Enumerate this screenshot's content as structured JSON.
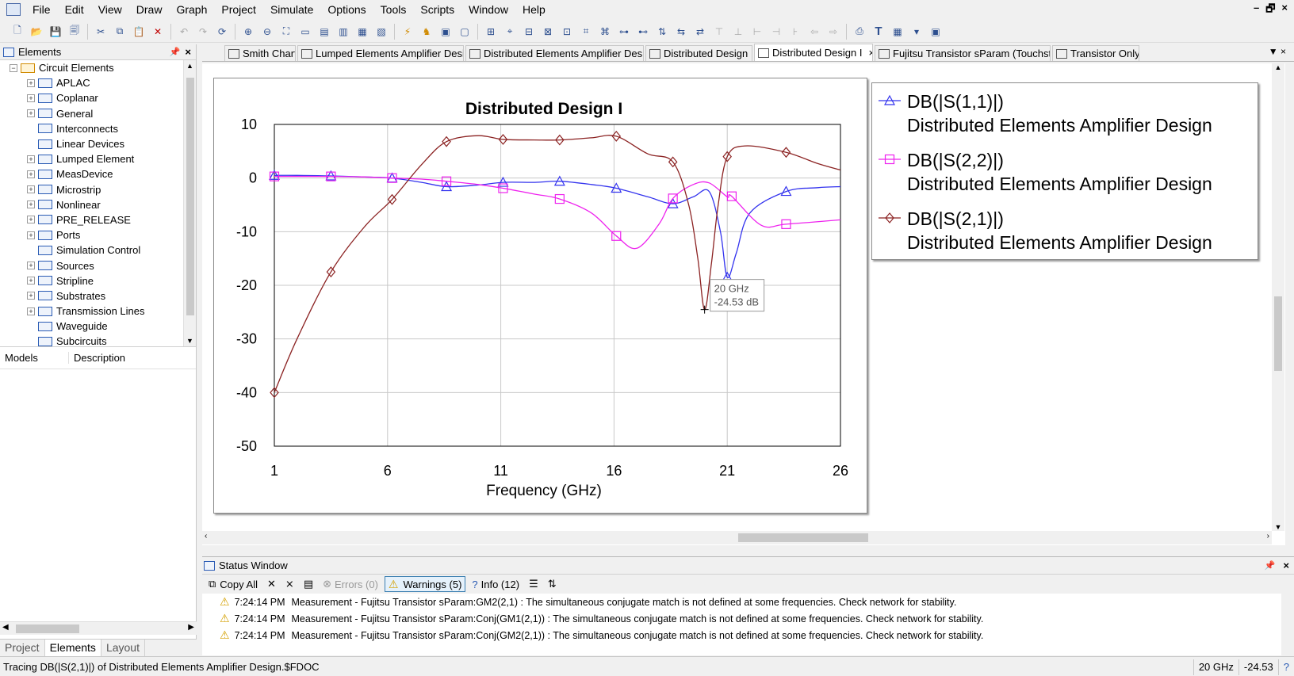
{
  "menu": {
    "items": [
      "File",
      "Edit",
      "View",
      "Draw",
      "Graph",
      "Project",
      "Simulate",
      "Options",
      "Tools",
      "Scripts",
      "Window",
      "Help"
    ]
  },
  "window_controls": [
    "–",
    "🗗",
    "×"
  ],
  "elements_panel": {
    "title": "Elements",
    "root": "Circuit Elements",
    "items": [
      {
        "label": "APLAC",
        "expandable": true
      },
      {
        "label": "Coplanar",
        "expandable": true
      },
      {
        "label": "General",
        "expandable": true
      },
      {
        "label": "Interconnects",
        "expandable": false
      },
      {
        "label": "Linear Devices",
        "expandable": false
      },
      {
        "label": "Lumped Element",
        "expandable": true
      },
      {
        "label": "MeasDevice",
        "expandable": true
      },
      {
        "label": "Microstrip",
        "expandable": true
      },
      {
        "label": "Nonlinear",
        "expandable": true
      },
      {
        "label": "PRE_RELEASE",
        "expandable": true
      },
      {
        "label": "Ports",
        "expandable": true
      },
      {
        "label": "Simulation Control",
        "expandable": false
      },
      {
        "label": "Sources",
        "expandable": true
      },
      {
        "label": "Stripline",
        "expandable": true
      },
      {
        "label": "Substrates",
        "expandable": true
      },
      {
        "label": "Transmission Lines",
        "expandable": true
      },
      {
        "label": "Waveguide",
        "expandable": false
      },
      {
        "label": "Subcircuits",
        "expandable": false
      }
    ],
    "models_header": {
      "col1": "Models",
      "col2": "Description"
    },
    "bottom_tabs": [
      "Project",
      "Elements",
      "Layout"
    ]
  },
  "doc_tabs": [
    {
      "label": "Smith Chart",
      "active": false
    },
    {
      "label": "Lumped Elements Amplifier Design",
      "active": false
    },
    {
      "label": "Distributed Elements Amplifier Des...",
      "active": false
    },
    {
      "label": "Distributed Design",
      "active": false
    },
    {
      "label": "Distributed Design I",
      "active": true
    },
    {
      "label": "Fujitsu Transistor sParam (Touchst...",
      "active": false
    },
    {
      "label": "Transistor Only",
      "active": false
    }
  ],
  "chart_data": {
    "type": "line",
    "title": "Distributed Design I",
    "xlabel": "Frequency (GHz)",
    "ylabel": "",
    "xlim": [
      1,
      26
    ],
    "ylim": [
      -50,
      10
    ],
    "xticks": [
      1,
      6,
      11,
      16,
      21,
      26
    ],
    "yticks": [
      10,
      0,
      -10,
      -20,
      -30,
      -40,
      -50
    ],
    "grid": true,
    "legend_position": "right",
    "series": [
      {
        "name": "DB(|S(1,1)|)",
        "source": "Distributed Elements Amplifier Design",
        "color": "#3333ee",
        "marker": "triangle",
        "x": [
          1,
          2,
          3.5,
          5,
          6.2,
          7.5,
          8.6,
          10,
          11.1,
          12.5,
          13.6,
          15,
          16.1,
          17.5,
          18.6,
          19.5,
          20.2,
          20.7,
          21,
          21.4,
          22,
          23.6,
          25,
          26
        ],
        "y": [
          0.5,
          0.5,
          0.4,
          0.2,
          0,
          -0.8,
          -1.6,
          -1.3,
          -0.8,
          -0.8,
          -0.6,
          -1.2,
          -1.9,
          -3.5,
          -4.8,
          -3.5,
          -2.5,
          -10,
          -18.5,
          -14,
          -6.5,
          -2.5,
          -1.8,
          -1.6
        ]
      },
      {
        "name": "DB(|S(2,2)|)",
        "source": "Distributed Elements Amplifier Design",
        "color": "#ee22ee",
        "marker": "square",
        "x": [
          1,
          3.5,
          5,
          6.2,
          7.5,
          8.6,
          10,
          11.1,
          12.5,
          13.6,
          15,
          16.1,
          17,
          18,
          18.6,
          19.5,
          20.2,
          21,
          21.2,
          22.5,
          23.6,
          26
        ],
        "y": [
          0.3,
          0.3,
          0.2,
          0,
          -0.2,
          -0.6,
          -1.2,
          -1.9,
          -3,
          -3.9,
          -6.5,
          -10.8,
          -13.1,
          -8.5,
          -3.8,
          -1.2,
          -0.9,
          -3.5,
          -3.4,
          -8.8,
          -8.6,
          -7.8
        ]
      },
      {
        "name": "DB(|S(2,1)|)",
        "source": "Distributed Elements Amplifier Design",
        "color": "#8b2222",
        "marker": "diamond",
        "x": [
          1,
          2,
          3.5,
          5,
          6.2,
          7.5,
          8.6,
          10,
          11.1,
          12.5,
          13.6,
          15,
          16.1,
          17.5,
          18.6,
          19.3,
          19.7,
          20,
          20.3,
          20.6,
          21,
          21.8,
          23.6,
          25,
          26
        ],
        "y": [
          -40,
          -30,
          -17.5,
          -9,
          -4,
          2.5,
          6.8,
          7.9,
          7.2,
          7.1,
          7.1,
          7.5,
          7.8,
          4.5,
          3,
          -5,
          -15,
          -24.53,
          -16,
          -5,
          4,
          6,
          4.8,
          2.7,
          1.5
        ]
      }
    ]
  },
  "cursor_tooltip": {
    "x_freq": 20,
    "y_db": -24.53,
    "line1": "20 GHz",
    "line2": "-24.53 dB"
  },
  "status_window": {
    "title": "Status Window",
    "buttons": {
      "copy_all": "Copy All",
      "errors": "Errors (0)",
      "warnings": "Warnings (5)",
      "info": "Info (12)"
    },
    "messages": [
      {
        "time": "7:24:14 PM",
        "text": "Measurement - Fujitsu Transistor sParam:GM2(2,1) : The simultaneous conjugate match is not defined at some frequencies. Check network for stability."
      },
      {
        "time": "7:24:14 PM",
        "text": "Measurement - Fujitsu Transistor sParam:Conj(GM1(2,1)) : The simultaneous conjugate match is not defined at some frequencies. Check network for stability."
      },
      {
        "time": "7:24:14 PM",
        "text": "Measurement - Fujitsu Transistor sParam:Conj(GM2(2,1)) : The simultaneous conjugate match is not defined at some frequencies. Check network for stability."
      }
    ]
  },
  "statusbar": {
    "text": "Tracing DB(|S(2,1)|) of Distributed Elements Amplifier Design.$FDOC",
    "freq": "20 GHz",
    "value": "-24.53"
  }
}
